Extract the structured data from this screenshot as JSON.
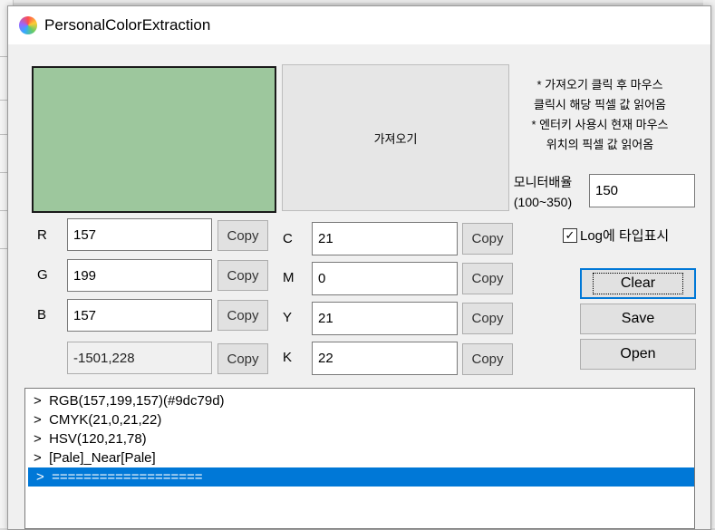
{
  "window": {
    "title": "PersonalColorExtraction"
  },
  "preview": {
    "swatch_color": "#9dc79d",
    "fetch_button_label": "가져오기"
  },
  "help": {
    "lines": [
      "* 가져오기 클릭 후 마우스",
      "클릭시 해당 픽셀 값 읽어옴",
      "* 엔터키 사용시 현재 마우스",
      "위치의 픽셀 값 읽어옴"
    ]
  },
  "monitor": {
    "label_line1": "모니터배율",
    "label_line2": "(100~350)",
    "value": "150"
  },
  "rgb": {
    "r_label": "R",
    "r_value": "157",
    "g_label": "G",
    "g_value": "199",
    "b_label": "B",
    "b_value": "157",
    "position_value": "-1501,228"
  },
  "cmyk": {
    "c_label": "C",
    "c_value": "21",
    "m_label": "M",
    "m_value": "0",
    "y_label": "Y",
    "y_value": "21",
    "k_label": "K",
    "k_value": "22"
  },
  "copy_label": "Copy",
  "log_type": {
    "checked": true,
    "label": "Log에 타입표시"
  },
  "buttons": {
    "clear": "Clear",
    "save": "Save",
    "open": "Open"
  },
  "log": {
    "lines": [
      ">  RGB(157,199,157)(#9dc79d)",
      ">  CMYK(21,0,21,22)",
      ">  HSV(120,21,78)",
      ">  [Pale]_Near[Pale]",
      ">  ==================="
    ],
    "selected_index": 4
  },
  "accent_color": "#0078d7"
}
